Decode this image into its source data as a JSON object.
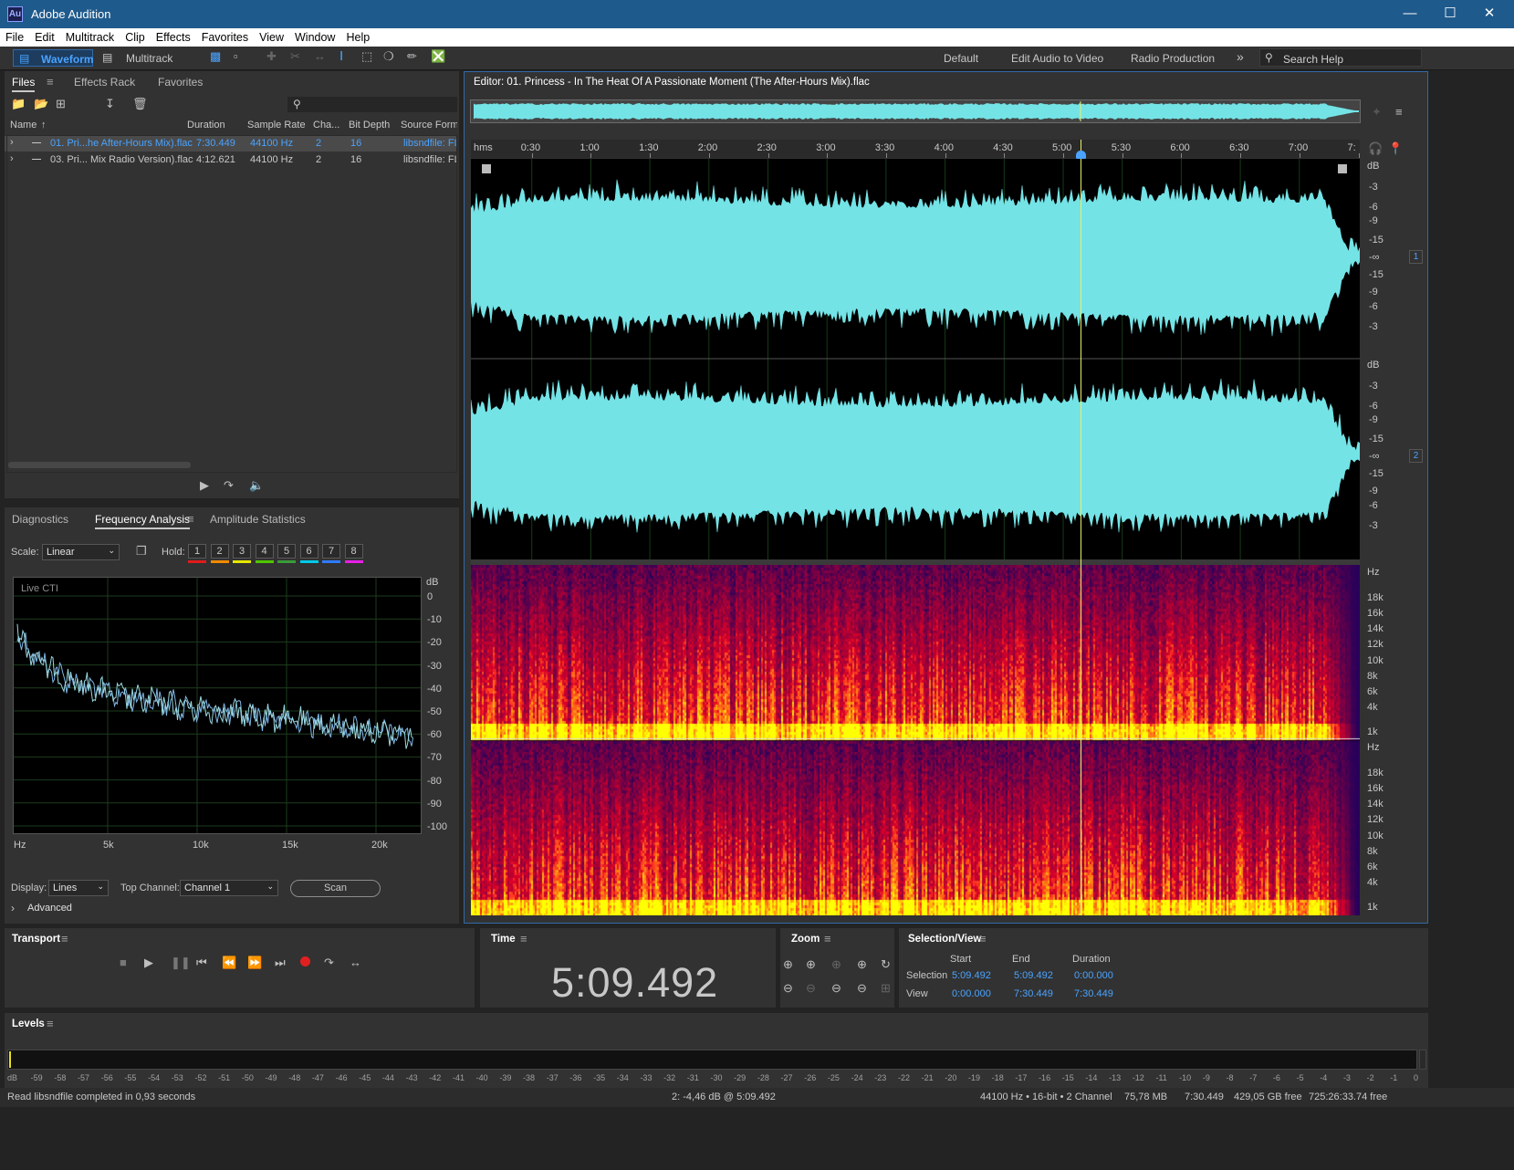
{
  "app": {
    "title": "Adobe Audition",
    "logo": "Au"
  },
  "menu": [
    "File",
    "Edit",
    "Multitrack",
    "Clip",
    "Effects",
    "Favorites",
    "View",
    "Window",
    "Help"
  ],
  "toolbar": {
    "waveform_label": "Waveform",
    "multitrack_label": "Multitrack",
    "workspaces": [
      "Default",
      "Edit Audio to Video",
      "Radio Production"
    ],
    "search_placeholder": "Search Help"
  },
  "files_panel": {
    "tabs": [
      "Files",
      "Effects Rack",
      "Favorites"
    ],
    "columns": [
      "Name",
      "Duration",
      "Sample Rate",
      "Cha...",
      "Bit Depth",
      "Source Forma"
    ],
    "rows": [
      {
        "name": "01. Pri...he After-Hours Mix).flac",
        "duration": "7:30.449",
        "sample_rate": "44100 Hz",
        "channels": "2",
        "bit_depth": "16",
        "source": "libsndfile: FL",
        "selected": true
      },
      {
        "name": "03. Pri... Mix Radio Version).flac",
        "duration": "4:12.621",
        "sample_rate": "44100 Hz",
        "channels": "2",
        "bit_depth": "16",
        "source": "libsndfile: FL",
        "selected": false
      }
    ]
  },
  "analysis_panel": {
    "tabs": [
      "Diagnostics",
      "Frequency Analysis",
      "Amplitude Statistics"
    ],
    "scale_label": "Scale:",
    "scale_value": "Linear",
    "hold_label": "Hold:",
    "hold_buttons": [
      "1",
      "2",
      "3",
      "4",
      "5",
      "6",
      "7",
      "8"
    ],
    "hold_colors": [
      "#e01b1b",
      "#f08a00",
      "#e6e600",
      "#4ec600",
      "#3a9a3a",
      "#00c8e6",
      "#2f7bff",
      "#e620e6"
    ],
    "live_label": "Live CTI",
    "db_label": "dB",
    "db_ticks": [
      "0",
      "-10",
      "-20",
      "-30",
      "-40",
      "-50",
      "-60",
      "-70",
      "-80",
      "-90",
      "-100"
    ],
    "hz_label": "Hz",
    "hz_ticks": [
      "5k",
      "10k",
      "15k",
      "20k"
    ],
    "display_label": "Display:",
    "display_value": "Lines",
    "top_channel_label": "Top Channel:",
    "top_channel_value": "Channel 1",
    "scan_label": "Scan",
    "advanced_label": "Advanced"
  },
  "editor": {
    "title": "Editor: 01. Princess - In The Heat Of A Passionate Moment (The After-Hours Mix).flac",
    "ruler_unit": "hms",
    "ruler_ticks": [
      "0:30",
      "1:00",
      "1:30",
      "2:00",
      "2:30",
      "3:00",
      "3:30",
      "4:00",
      "4:30",
      "5:00",
      "5:30",
      "6:00",
      "6:30",
      "7:00",
      "7:"
    ],
    "db_label": "dB",
    "db_ticks_top": [
      "-3",
      "-6",
      "-9",
      "-15",
      "-∞",
      "-15",
      "-9",
      "-6",
      "-3"
    ],
    "channel_numbers": [
      "1",
      "2"
    ],
    "hz_label": "Hz",
    "hz_ticks": [
      "18k",
      "16k",
      "14k",
      "12k",
      "10k",
      "8k",
      "6k",
      "4k",
      "1k"
    ]
  },
  "transport": {
    "title": "Transport"
  },
  "time_panel": {
    "title": "Time",
    "value": "5:09.492"
  },
  "zoom_panel": {
    "title": "Zoom"
  },
  "selection_panel": {
    "title": "Selection/View",
    "col_start": "Start",
    "col_end": "End",
    "col_duration": "Duration",
    "selection_label": "Selection",
    "selection_start": "5:09.492",
    "selection_end": "5:09.492",
    "selection_duration": "0:00.000",
    "view_label": "View",
    "view_start": "0:00.000",
    "view_end": "7:30.449",
    "view_duration": "7:30.449"
  },
  "levels": {
    "title": "Levels",
    "scale": [
      "dB",
      "-59",
      "-58",
      "-57",
      "-56",
      "-55",
      "-54",
      "-53",
      "-52",
      "-51",
      "-50",
      "-49",
      "-48",
      "-47",
      "-46",
      "-45",
      "-44",
      "-43",
      "-42",
      "-41",
      "-40",
      "-39",
      "-38",
      "-37",
      "-36",
      "-35",
      "-34",
      "-33",
      "-32",
      "-31",
      "-30",
      "-29",
      "-28",
      "-27",
      "-26",
      "-25",
      "-24",
      "-23",
      "-22",
      "-21",
      "-20",
      "-19",
      "-18",
      "-17",
      "-16",
      "-15",
      "-14",
      "-13",
      "-12",
      "-11",
      "-10",
      "-9",
      "-8",
      "-7",
      "-6",
      "-5",
      "-4",
      "-3",
      "-2",
      "-1",
      "0"
    ]
  },
  "status": {
    "left": "Read libsndfile completed in 0,93 seconds",
    "cursor": "2: -4,46 dB @ 5:09.492",
    "format": "44100 Hz • 16-bit • 2 Channel",
    "size": "75,78 MB",
    "duration": "7:30.449",
    "free": "429,05 GB free",
    "free_time": "725:26:33.74 free"
  },
  "colors": {
    "waveform": "#74e3e6",
    "playhead": "#e8f06a",
    "accent": "#4aa3ff",
    "spectrum_line": "#7fb6e6"
  }
}
